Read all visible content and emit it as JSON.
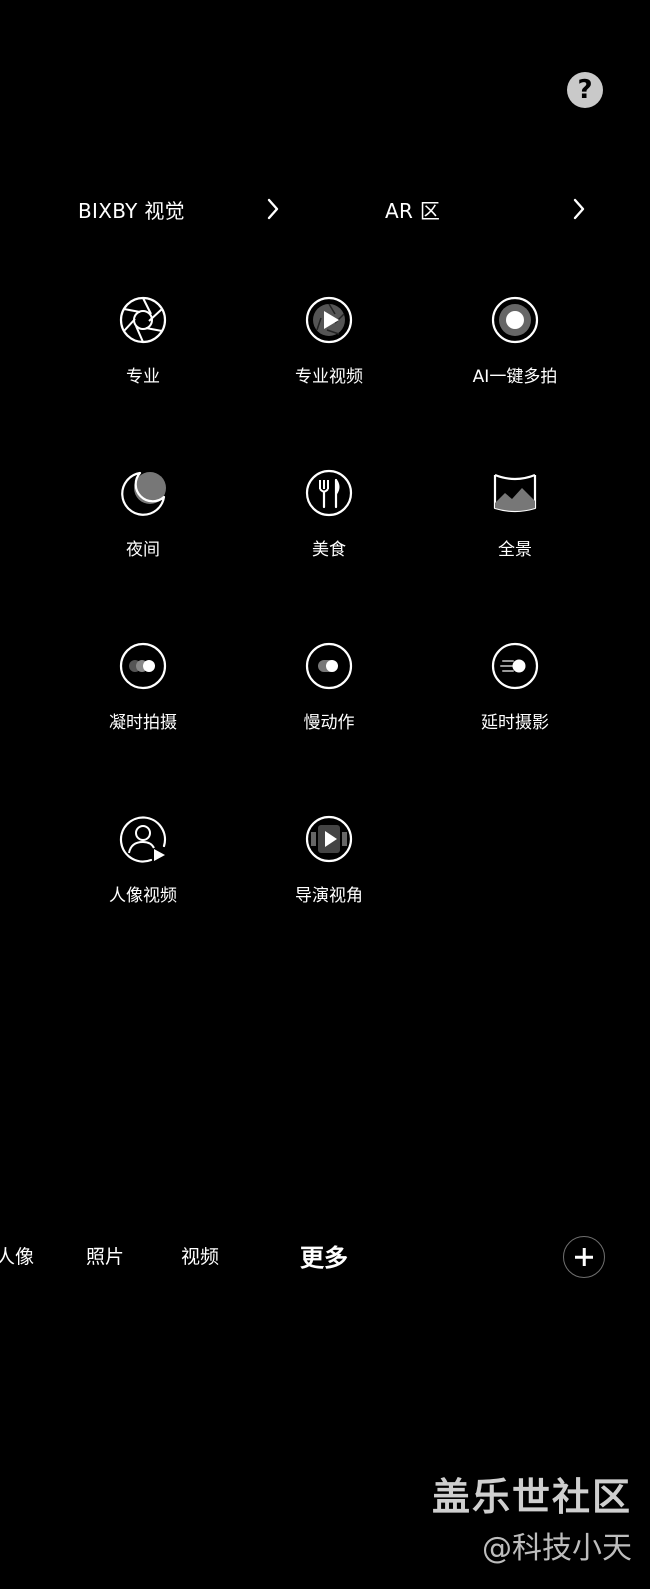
{
  "help": {
    "label": "?"
  },
  "shortcuts": [
    {
      "label": "BIXBY 视觉",
      "icon": "chevron-right-icon"
    },
    {
      "label": "AR 区",
      "icon": "chevron-right-icon"
    }
  ],
  "modes": [
    {
      "label": "专业",
      "icon": "aperture-icon"
    },
    {
      "label": "专业视频",
      "icon": "pro-video-icon"
    },
    {
      "label": "AI一键多拍",
      "icon": "single-take-icon"
    },
    {
      "label": "夜间",
      "icon": "moon-icon"
    },
    {
      "label": "美食",
      "icon": "food-icon"
    },
    {
      "label": "全景",
      "icon": "panorama-icon"
    },
    {
      "label": "凝时拍摄",
      "icon": "hyperlapse-icon"
    },
    {
      "label": "慢动作",
      "icon": "slow-motion-icon"
    },
    {
      "label": "延时摄影",
      "icon": "timelapse-icon"
    },
    {
      "label": "人像视频",
      "icon": "portrait-video-icon"
    },
    {
      "label": "导演视角",
      "icon": "directors-view-icon"
    }
  ],
  "tabs": [
    {
      "label": "人像"
    },
    {
      "label": "照片"
    },
    {
      "label": "视频"
    },
    {
      "label": "更多",
      "active": true
    }
  ],
  "add_button": {
    "icon": "plus-icon"
  },
  "watermark": {
    "main": "盖乐世社区",
    "sub": "@科技小天"
  }
}
